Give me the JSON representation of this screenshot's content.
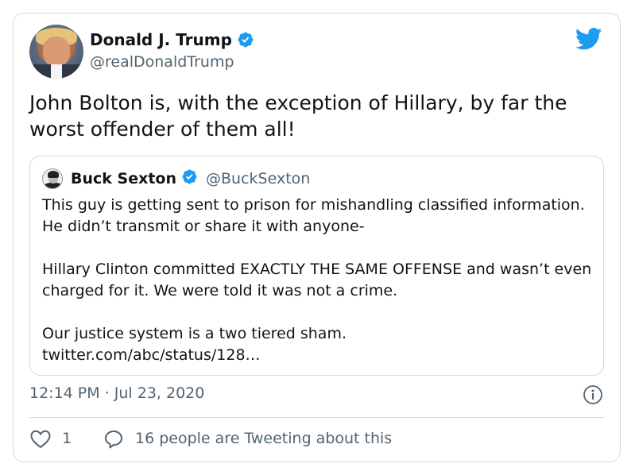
{
  "author": {
    "display_name": "Donald J. Trump",
    "handle": "@realDonaldTrump",
    "verified": true
  },
  "tweet": {
    "text": "John Bolton is, with the exception of Hillary, by far the worst offender of them all!",
    "timestamp": "12:14 PM · Jul 23, 2020"
  },
  "quoted_tweet": {
    "display_name": "Buck Sexton",
    "handle": "@BuckSexton",
    "verified": true,
    "paragraphs": [
      "This guy is getting sent to prison for mishandling classified information. He didn’t transmit or share it with anyone-",
      "Hillary Clinton committed EXACTLY THE SAME OFFENSE and wasn’t even charged for it. We were told it was not a crime.",
      "Our justice system is a two tiered sham.",
      "twitter.com/abc/status/128…"
    ]
  },
  "engagement": {
    "like_count": "1",
    "reply_text": "16 people are Tweeting about this"
  },
  "icons": {
    "brand": "twitter-bird-icon",
    "verified": "verified-badge-icon",
    "info": "info-icon",
    "like": "heart-icon",
    "reply": "speech-bubble-icon"
  },
  "colors": {
    "brand_blue": "#1d9bf0",
    "text": "#0f1419",
    "secondary_text": "#536471",
    "border": "#cfd9de"
  }
}
